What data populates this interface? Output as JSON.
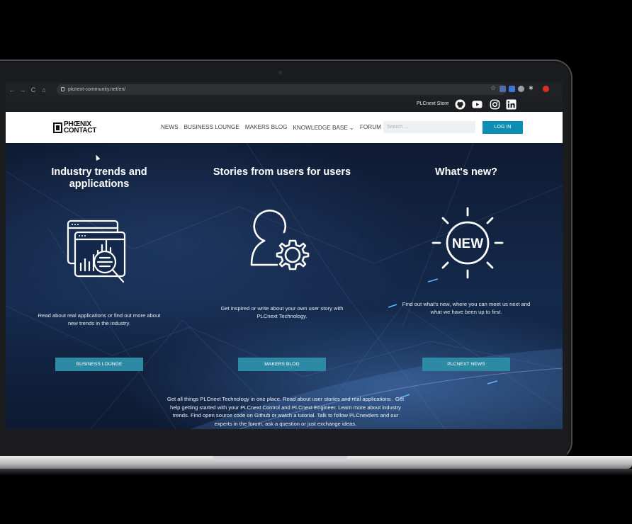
{
  "browser": {
    "url": "plcnext-community.net/en/",
    "nav_icons": [
      "arrow-left-icon",
      "arrow-right-icon",
      "reload-icon",
      "home-icon"
    ]
  },
  "utility": {
    "store_label": "PLCnext Store",
    "social_icons": [
      "github-icon",
      "youtube-icon",
      "instagram-icon",
      "linkedin-icon"
    ]
  },
  "header": {
    "logo_line1": "PHŒNIX",
    "logo_line2": "CONTACT",
    "nav": [
      {
        "label": "NEWS"
      },
      {
        "label": "BUSINESS LOUNGE"
      },
      {
        "label": "MAKERS BLOG"
      },
      {
        "label": "KNOWLEDGE BASE ⌄"
      },
      {
        "label": "FORUM"
      }
    ],
    "search_placeholder": "Search ...",
    "login_label": "LOG IN"
  },
  "hero": {
    "columns": [
      {
        "title_line1": "Industry trends and",
        "title_line2": "applications",
        "icon": "analytics-magnifier-icon",
        "desc_line1": "Read about real applications or find out more about",
        "desc_line2": "new trends in the industry.",
        "button": "BUSINESS LOUNGE"
      },
      {
        "title_line1": "Stories from users for users",
        "icon": "user-gear-icon",
        "desc_line1": "Get inspired or write about your own user story with",
        "desc_line2": "PLCnext Technology.",
        "button": "MAKERS BLOG"
      },
      {
        "title_line1": "What's new?",
        "icon": "new-badge-icon",
        "icon_text": "NEW",
        "desc_line1": "Find out what's new, where you can meet us next and",
        "desc_line2": "what we have been up to first.",
        "button": "PLCNEXT NEWS"
      }
    ],
    "footer_line1": "Get all things PLCnext Technology in one place. Read about user stories and real applications . Get",
    "footer_line2": "help getting started with your PLCnext Control and PLCnext Engineer. Learn more about industry",
    "footer_line3": "trends. Find open source code on Github or watch a tutorial. Talk to follow PLCnextlers and our",
    "footer_line4": "experts in the forum, ask a question or just exchange ideas."
  },
  "colors": {
    "accent_button": "#2c8aa5",
    "login_button": "#0c8db3",
    "hero_dark": "#0f1b33"
  }
}
